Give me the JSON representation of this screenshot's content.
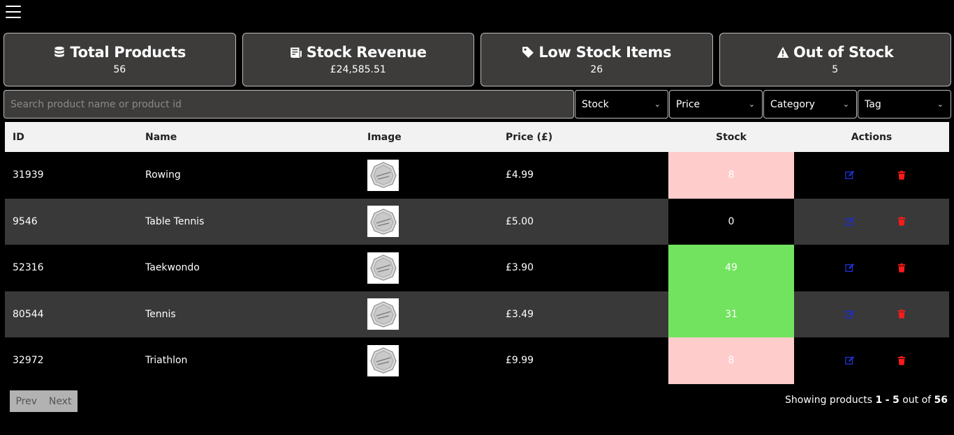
{
  "summary": [
    {
      "title": "Total Products",
      "value": "56",
      "icon": "database-icon"
    },
    {
      "title": "Stock Revenue",
      "value": "£24,585.51",
      "icon": "receipt-icon"
    },
    {
      "title": "Low Stock Items",
      "value": "26",
      "icon": "tag-icon"
    },
    {
      "title": "Out of Stock",
      "value": "5",
      "icon": "warning-icon"
    }
  ],
  "search": {
    "placeholder": "Search product name or product id"
  },
  "filters": {
    "stock": "Stock",
    "price": "Price",
    "category": "Category",
    "tag": "Tag"
  },
  "table": {
    "headers": {
      "id": "ID",
      "name": "Name",
      "image": "Image",
      "price": "Price (£)",
      "stock": "Stock",
      "actions": "Actions"
    },
    "rows": [
      {
        "id": "31939",
        "name": "Rowing",
        "price": "£4.99",
        "stock": "8",
        "stock_status": "low"
      },
      {
        "id": "9546",
        "name": "Table Tennis",
        "price": "£5.00",
        "stock": "0",
        "stock_status": "out"
      },
      {
        "id": "52316",
        "name": "Taekwondo",
        "price": "£3.90",
        "stock": "49",
        "stock_status": "ok"
      },
      {
        "id": "80544",
        "name": "Tennis",
        "price": "£3.49",
        "stock": "31",
        "stock_status": "ok"
      },
      {
        "id": "32972",
        "name": "Triathlon",
        "price": "£9.99",
        "stock": "8",
        "stock_status": "low"
      }
    ]
  },
  "colors": {
    "low": "#ffcccc",
    "ok": "#72e35f",
    "edit": "#1d2fc9",
    "delete": "#ff1a1a"
  },
  "pager": {
    "prev": "Prev",
    "next": "Next"
  },
  "showing": {
    "prefix": "Showing products",
    "from": "1",
    "sep": "-",
    "to": "5",
    "middle": "out of",
    "total": "56"
  }
}
